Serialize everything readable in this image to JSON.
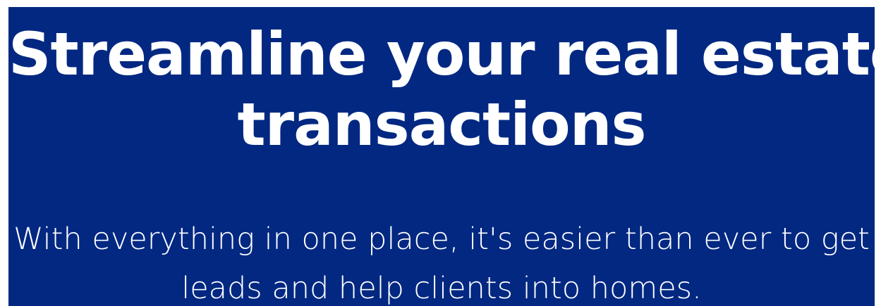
{
  "hero": {
    "background_color": "#022882",
    "text_color": "#ffffff",
    "headline_line_1": "Streamline your real estate",
    "headline_line_2": "transactions",
    "subtext_line_1": "With everything in one place, it's easier than ever to get",
    "subtext_line_2": "leads and help clients into homes."
  }
}
